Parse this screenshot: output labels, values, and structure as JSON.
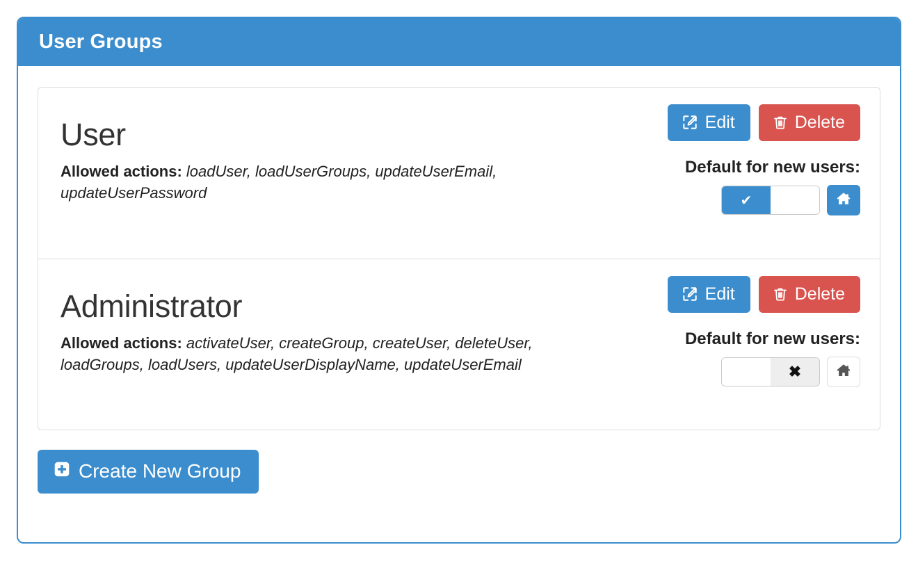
{
  "panel": {
    "title": "User Groups"
  },
  "groups": [
    {
      "name": "User",
      "actions_label": "Allowed actions:",
      "actions_value": "loadUser, loadUserGroups, updateUserEmail, updateUserPassword",
      "edit_label": "Edit",
      "delete_label": "Delete",
      "default_label": "Default for new users:",
      "default_state": "on",
      "toggle_on_symbol": "✔",
      "toggle_off_symbol": "✖",
      "home_style": "primary"
    },
    {
      "name": "Administrator",
      "actions_label": "Allowed actions:",
      "actions_value": "activateUser, createGroup, createUser, deleteUser, loadGroups, loadUsers, updateUserDisplayName, updateUserEmail",
      "edit_label": "Edit",
      "delete_label": "Delete",
      "default_label": "Default for new users:",
      "default_state": "off",
      "toggle_on_symbol": "✔",
      "toggle_off_symbol": "✖",
      "home_style": "plain"
    }
  ],
  "footer": {
    "create_label": "Create New Group"
  },
  "colors": {
    "primary": "#3c8dcd",
    "danger": "#d9534f",
    "border": "#dddddd",
    "text": "#222222"
  }
}
